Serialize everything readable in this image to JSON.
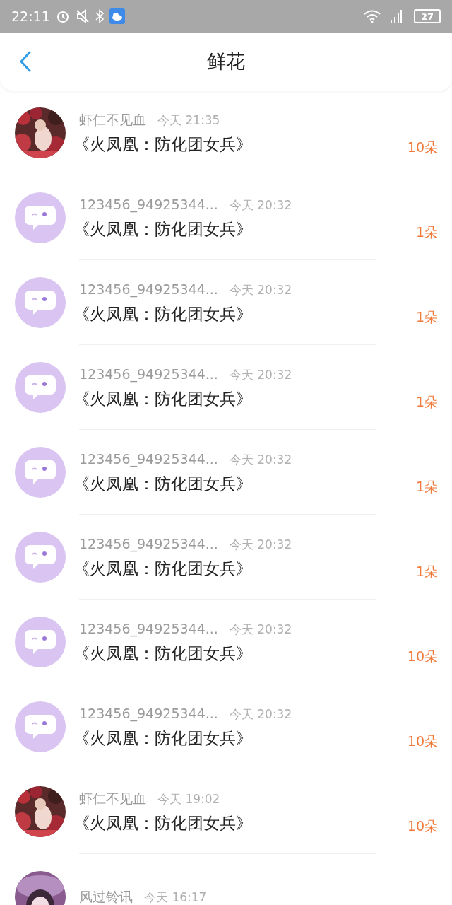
{
  "status_bar": {
    "time": "22:11",
    "battery": "27"
  },
  "header": {
    "title": "鲜花"
  },
  "rows": [
    {
      "name": "虾仁不见血",
      "time": "今天 21:35",
      "title": "《火凤凰：防化团女兵》",
      "amount": "10朵"
    },
    {
      "kind": "default",
      "name": "123456_94925344...",
      "time": "今天 20:32",
      "title": "《火凤凰：防化团女兵》",
      "amount": "1朵"
    },
    {
      "kind": "default",
      "name": "123456_94925344...",
      "time": "今天 20:32",
      "title": "《火凤凰：防化团女兵》",
      "amount": "1朵"
    },
    {
      "kind": "default",
      "name": "123456_94925344...",
      "time": "今天 20:32",
      "title": "《火凤凰：防化团女兵》",
      "amount": "1朵"
    },
    {
      "kind": "default",
      "name": "123456_94925344...",
      "time": "今天 20:32",
      "title": "《火凤凰：防化团女兵》",
      "amount": "1朵"
    },
    {
      "kind": "default",
      "name": "123456_94925344...",
      "time": "今天 20:32",
      "title": "《火凤凰：防化团女兵》",
      "amount": "1朵"
    },
    {
      "kind": "default",
      "name": "123456_94925344...",
      "time": "今天 20:32",
      "title": "《火凤凰：防化团女兵》",
      "amount": "10朵"
    },
    {
      "kind": "default",
      "name": "123456_94925344...",
      "time": "今天 20:32",
      "title": "《火凤凰：防化团女兵》",
      "amount": "10朵"
    },
    {
      "name": "虾仁不见血",
      "time": "今天 19:02",
      "title": "《火凤凰：防化团女兵》",
      "amount": "10朵"
    },
    {
      "kind": "cartoon",
      "name": "风过铃讯",
      "time": "今天 16:17"
    }
  ]
}
